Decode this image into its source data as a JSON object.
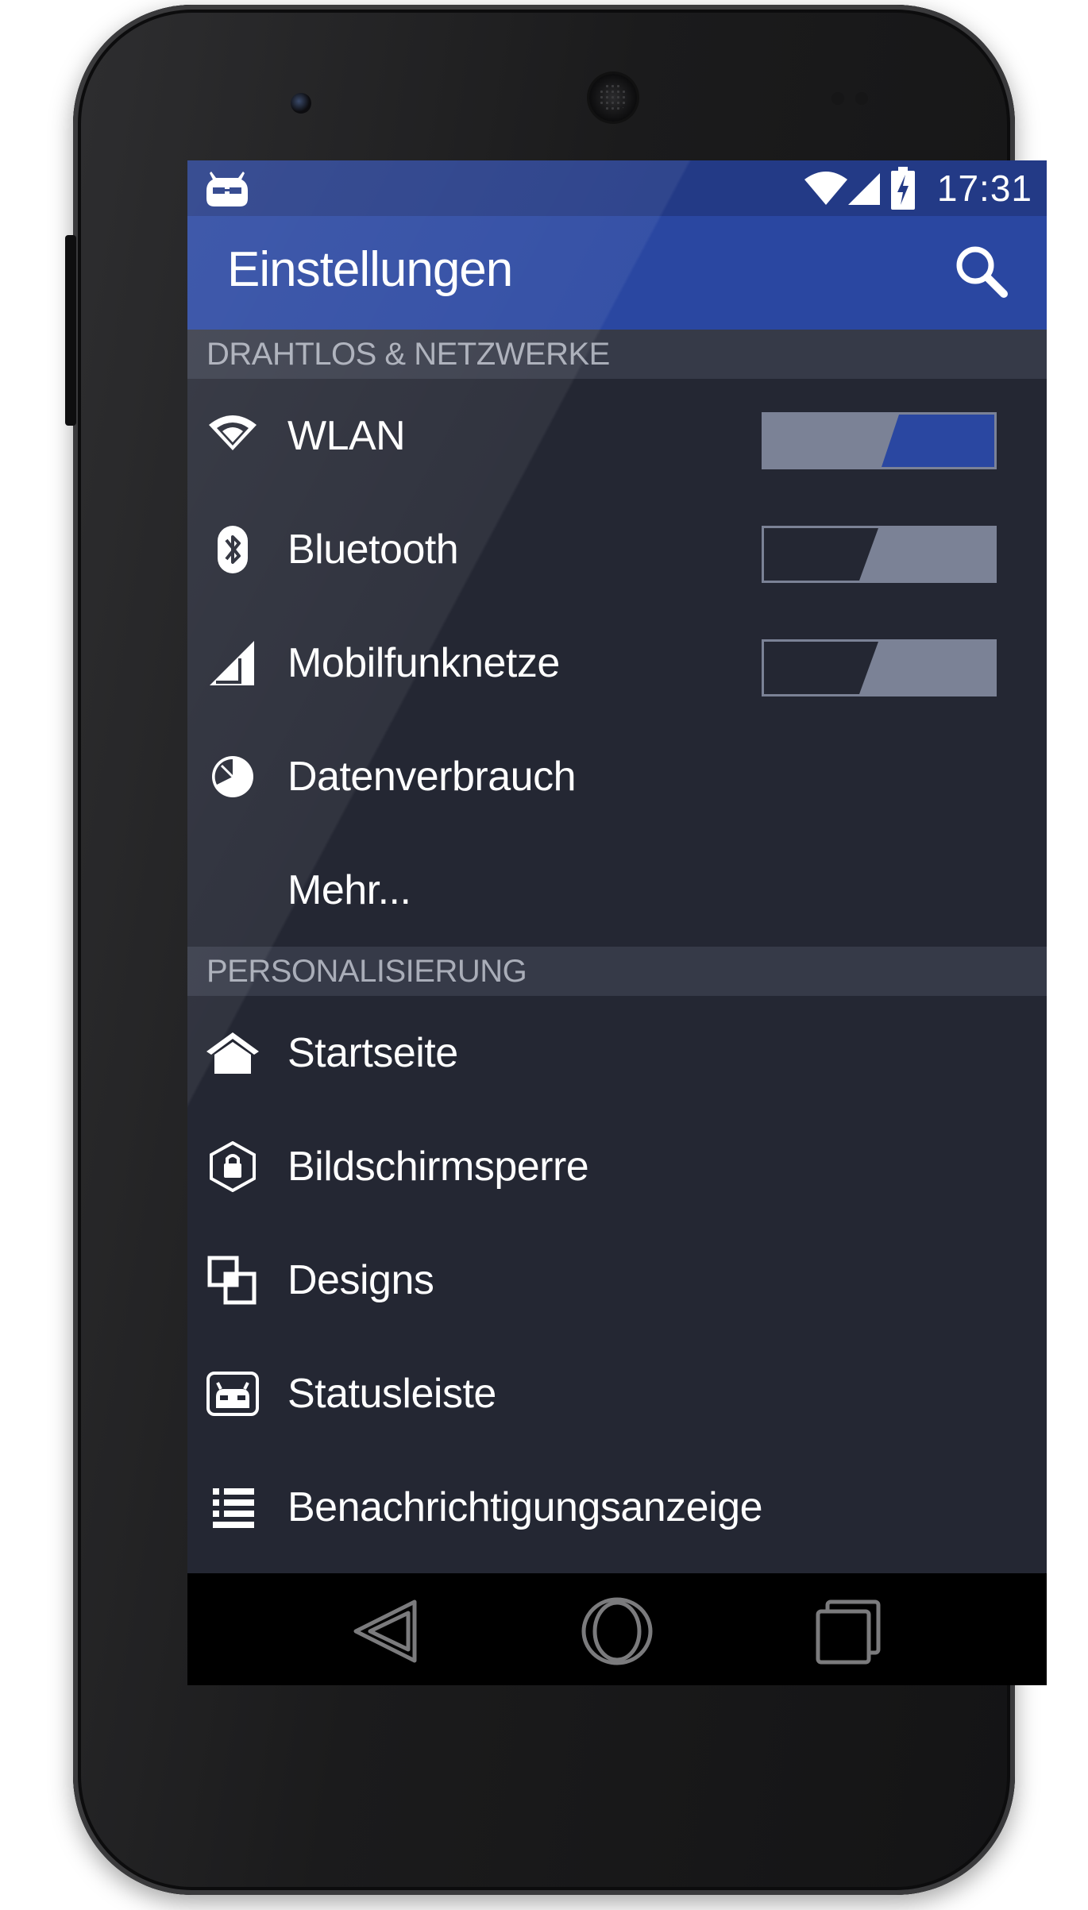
{
  "status_bar": {
    "time": "17:31",
    "icons": [
      "cyanogenmod-icon",
      "wifi-icon",
      "cell-signal-icon",
      "battery-charging-icon"
    ]
  },
  "app_bar": {
    "title": "Einstellungen",
    "action_icon": "search-icon"
  },
  "sections": [
    {
      "header": "DRAHTLOS & NETZWERKE",
      "items": [
        {
          "label": "WLAN",
          "icon": "wifi-icon",
          "toggle": true,
          "on": true
        },
        {
          "label": "Bluetooth",
          "icon": "bluetooth-icon",
          "toggle": true,
          "on": false
        },
        {
          "label": "Mobilfunknetze",
          "icon": "cell-signal-icon",
          "toggle": true,
          "on": false
        },
        {
          "label": "Datenverbrauch",
          "icon": "data-usage-icon",
          "toggle": false
        },
        {
          "label": "Mehr...",
          "icon": "",
          "toggle": false
        }
      ]
    },
    {
      "header": "PERSONALISIERUNG",
      "items": [
        {
          "label": "Startseite",
          "icon": "home-icon",
          "toggle": false
        },
        {
          "label": "Bildschirmsperre",
          "icon": "lock-icon",
          "toggle": false
        },
        {
          "label": "Designs",
          "icon": "themes-icon",
          "toggle": false
        },
        {
          "label": "Statusleiste",
          "icon": "status-bar-icon",
          "toggle": false
        },
        {
          "label": "Benachrichtigungsanzeige",
          "icon": "notification-drawer-icon",
          "toggle": false
        }
      ]
    }
  ],
  "nav_bar": {
    "buttons": [
      "back-icon",
      "home-circle-icon",
      "recents-icon"
    ]
  },
  "colors": {
    "status_bar": "#233a86",
    "app_bar": "#2a47a1",
    "background": "#242733",
    "section_header": "#363a48",
    "toggle_on": "#2a47a1",
    "toggle_off": "#7b8296"
  }
}
